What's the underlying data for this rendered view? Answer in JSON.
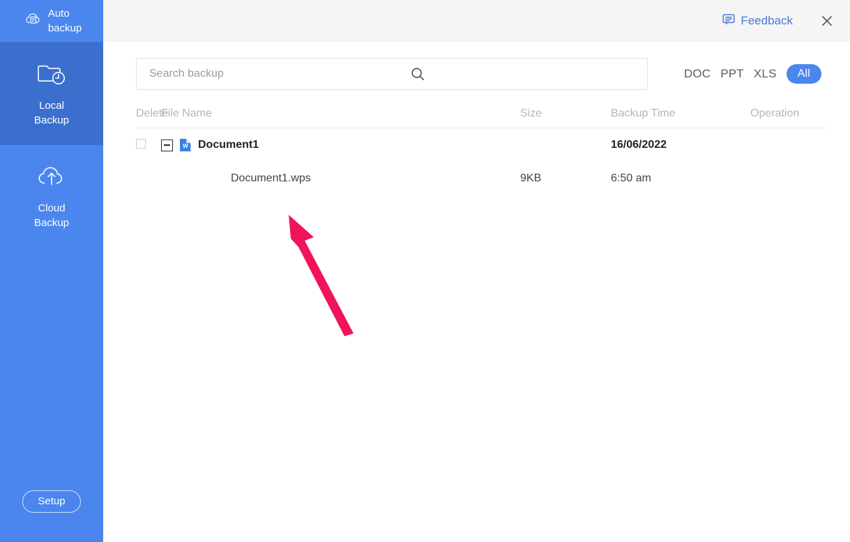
{
  "app": {
    "accent_blue": "#4a86ee",
    "active_blue": "#3a6fce",
    "topbar_bg": "#f5f5f5",
    "arrow_color": "#f0145a"
  },
  "sidebar": {
    "items": [
      {
        "label": "Auto\nbackup",
        "icon": "cloud-document-icon",
        "active": false
      },
      {
        "label": "Local\nBackup",
        "icon": "folder-clock-icon",
        "active": true
      },
      {
        "label": "Cloud\nBackup",
        "icon": "cloud-upload-icon",
        "active": false
      }
    ],
    "setup_label": "Setup"
  },
  "topbar": {
    "feedback_label": "Feedback",
    "feedback_icon": "chat-bubble-icon",
    "close_icon": "close-icon"
  },
  "search": {
    "placeholder": "Search backup",
    "value": "",
    "icon": "search-icon"
  },
  "filters": [
    {
      "label": "DOC",
      "active": false
    },
    {
      "label": "PPT",
      "active": false
    },
    {
      "label": "XLS",
      "active": false
    },
    {
      "label": "All",
      "active": true
    }
  ],
  "table": {
    "headers": {
      "delete": "Delete",
      "name": "File Name",
      "size": "Size",
      "time": "Backup Time",
      "operation": "Operation"
    },
    "rows": [
      {
        "type": "group",
        "name": "Document1",
        "size": "",
        "time": "16/06/2022",
        "operation": "",
        "icon": "wps-writer-icon",
        "collapse_icon": "minus-box-icon"
      },
      {
        "type": "child",
        "name": "Document1.wps",
        "size": "9KB",
        "time": "6:50 am",
        "operation": ""
      }
    ]
  },
  "annotation": {
    "type": "arrow",
    "points_to": "Document1.wps"
  }
}
